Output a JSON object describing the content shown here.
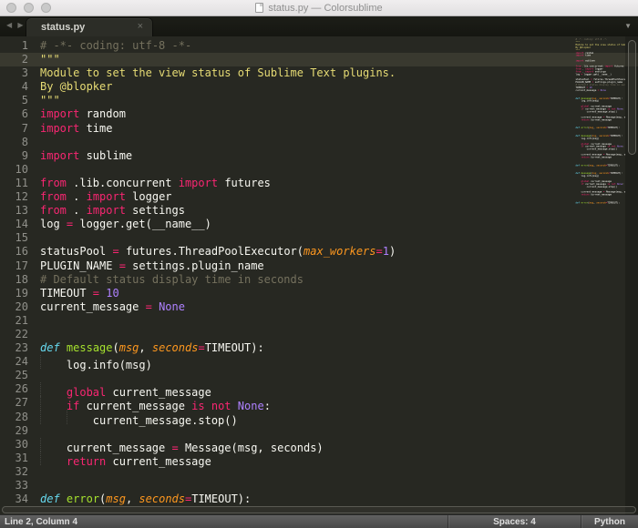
{
  "window": {
    "title": "status.py — Colorsublime"
  },
  "tabs": {
    "items": [
      {
        "label": "status.py"
      }
    ],
    "icons": {
      "back": "◀",
      "forward": "▶",
      "close": "×",
      "overflow": "▼"
    }
  },
  "editor": {
    "current_line": 2,
    "lines": [
      [
        [
          "# -*- coding: utf-8 -*-",
          "com"
        ]
      ],
      [
        [
          "\"\"\"",
          "str"
        ]
      ],
      [
        [
          "Module to set the view status of Sublime Text plugins.",
          "str"
        ]
      ],
      [
        [
          "By @blopker",
          "str"
        ]
      ],
      [
        [
          "\"\"\"",
          "str"
        ]
      ],
      [
        [
          "import",
          "kw"
        ],
        [
          " random",
          "pln"
        ]
      ],
      [
        [
          "import",
          "kw"
        ],
        [
          " time",
          "pln"
        ]
      ],
      [],
      [
        [
          "import",
          "kw"
        ],
        [
          " sublime",
          "pln"
        ]
      ],
      [],
      [
        [
          "from",
          "kw"
        ],
        [
          " .lib.concurrent ",
          "pln"
        ],
        [
          "import",
          "kw"
        ],
        [
          " futures",
          "pln"
        ]
      ],
      [
        [
          "from",
          "kw"
        ],
        [
          " . ",
          "pln"
        ],
        [
          "import",
          "kw"
        ],
        [
          " logger",
          "pln"
        ]
      ],
      [
        [
          "from",
          "kw"
        ],
        [
          " . ",
          "pln"
        ],
        [
          "import",
          "kw"
        ],
        [
          " settings",
          "pln"
        ]
      ],
      [
        [
          "log ",
          "pln"
        ],
        [
          "=",
          "kw"
        ],
        [
          " logger.get(__name__)",
          "pln"
        ]
      ],
      [],
      [
        [
          "statusPool ",
          "pln"
        ],
        [
          "=",
          "kw"
        ],
        [
          " futures.ThreadPoolExecutor(",
          "pln"
        ],
        [
          "max_workers",
          "par"
        ],
        [
          "=",
          "kw"
        ],
        [
          "1",
          "cst"
        ],
        [
          ")",
          "pln"
        ]
      ],
      [
        [
          "PLUGIN_NAME ",
          "pln"
        ],
        [
          "=",
          "kw"
        ],
        [
          " settings.plugin_name",
          "pln"
        ]
      ],
      [
        [
          "# Default status display time in seconds",
          "com"
        ]
      ],
      [
        [
          "TIMEOUT ",
          "pln"
        ],
        [
          "=",
          "kw"
        ],
        [
          " ",
          "pln"
        ],
        [
          "10",
          "cst"
        ]
      ],
      [
        [
          "current_message ",
          "pln"
        ],
        [
          "=",
          "kw"
        ],
        [
          " ",
          "pln"
        ],
        [
          "None",
          "cst"
        ]
      ],
      [],
      [],
      [
        [
          "def",
          "def"
        ],
        [
          " ",
          "pln"
        ],
        [
          "message",
          "fn"
        ],
        [
          "(",
          "pln"
        ],
        [
          "msg",
          "par"
        ],
        [
          ", ",
          "pln"
        ],
        [
          "seconds",
          "par"
        ],
        [
          "=",
          "kw"
        ],
        [
          "TIMEOUT):",
          "pln"
        ]
      ],
      [
        [
          "    log.info(msg)",
          "pln"
        ]
      ],
      [],
      [
        [
          "    ",
          "pln"
        ],
        [
          "global",
          "kw"
        ],
        [
          " current_message",
          "pln"
        ]
      ],
      [
        [
          "    ",
          "pln"
        ],
        [
          "if",
          "kw"
        ],
        [
          " current_message ",
          "pln"
        ],
        [
          "is",
          "kw"
        ],
        [
          " ",
          "pln"
        ],
        [
          "not",
          "kw"
        ],
        [
          " ",
          "pln"
        ],
        [
          "None",
          "cst"
        ],
        [
          ":",
          "pln"
        ]
      ],
      [
        [
          "        current_message.stop()",
          "pln"
        ]
      ],
      [],
      [
        [
          "    current_message ",
          "pln"
        ],
        [
          "=",
          "kw"
        ],
        [
          " Message(msg, seconds)",
          "pln"
        ]
      ],
      [
        [
          "    ",
          "pln"
        ],
        [
          "return",
          "kw"
        ],
        [
          " current_message",
          "pln"
        ]
      ],
      [],
      [],
      [
        [
          "def",
          "def"
        ],
        [
          " ",
          "pln"
        ],
        [
          "error",
          "fn"
        ],
        [
          "(",
          "pln"
        ],
        [
          "msg",
          "par"
        ],
        [
          ", ",
          "pln"
        ],
        [
          "seconds",
          "par"
        ],
        [
          "=",
          "kw"
        ],
        [
          "TIMEOUT):",
          "pln"
        ]
      ]
    ]
  },
  "status_bar": {
    "position": "Line 2, Column 4",
    "spaces": "Spaces: 4",
    "language": "Python"
  },
  "colors": {
    "bg": "#272822",
    "fg": "#f8f8f2",
    "com": "#75715e",
    "str": "#e6db74",
    "kw": "#f92672",
    "fn": "#a6e22e",
    "par": "#fd971f",
    "cst": "#ae81ff",
    "def": "#66d9ef",
    "gut": "#90908a",
    "hl": "#39392f"
  }
}
